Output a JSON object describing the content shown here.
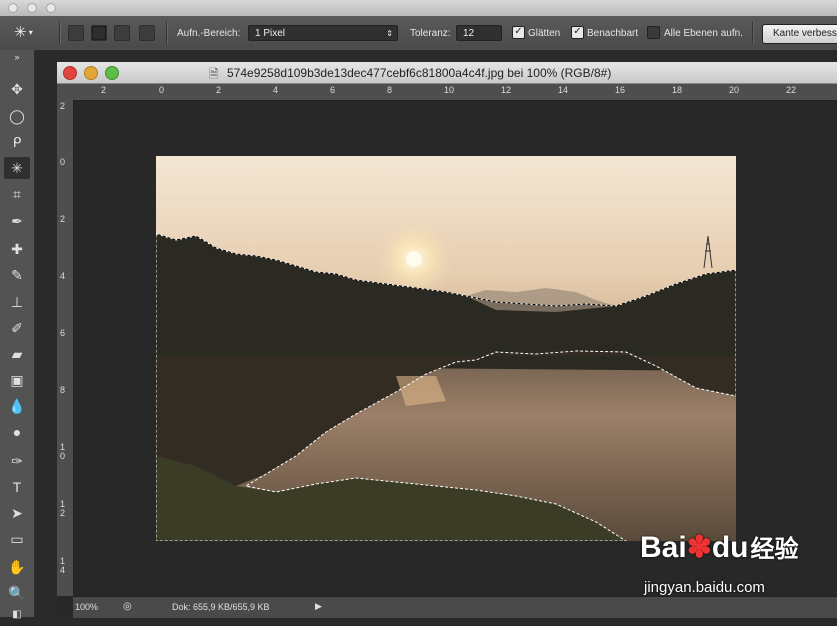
{
  "options": {
    "area_label": "Aufn.-Bereich:",
    "area_value": "1 Pixel",
    "tolerance_label": "Toleranz:",
    "tolerance_value": "12",
    "smooth_label": "Glätten",
    "contiguous_label": "Benachbart",
    "all_layers_label": "Alle Ebenen aufn.",
    "refine_edge_label": "Kante verbesse"
  },
  "document": {
    "title": "574e9258d109b3de13dec477cebf6c81800a4c4f.jpg bei 100% (RGB/8#)"
  },
  "ruler_h": [
    "2",
    "0",
    "2",
    "4",
    "6",
    "8",
    "10",
    "12",
    "14",
    "16",
    "18",
    "20",
    "22"
  ],
  "ruler_v": [
    "2",
    "0",
    "2",
    "4",
    "6",
    "8",
    "1\n0",
    "1\n2",
    "1\n4"
  ],
  "status": {
    "zoom": "100%",
    "doc_info": "Dok: 655,9 KB/655,9 KB"
  },
  "watermark": {
    "brand": "Bai",
    "brand_tail": "du",
    "cn": "经验",
    "url": "jingyan.baidu.com"
  }
}
